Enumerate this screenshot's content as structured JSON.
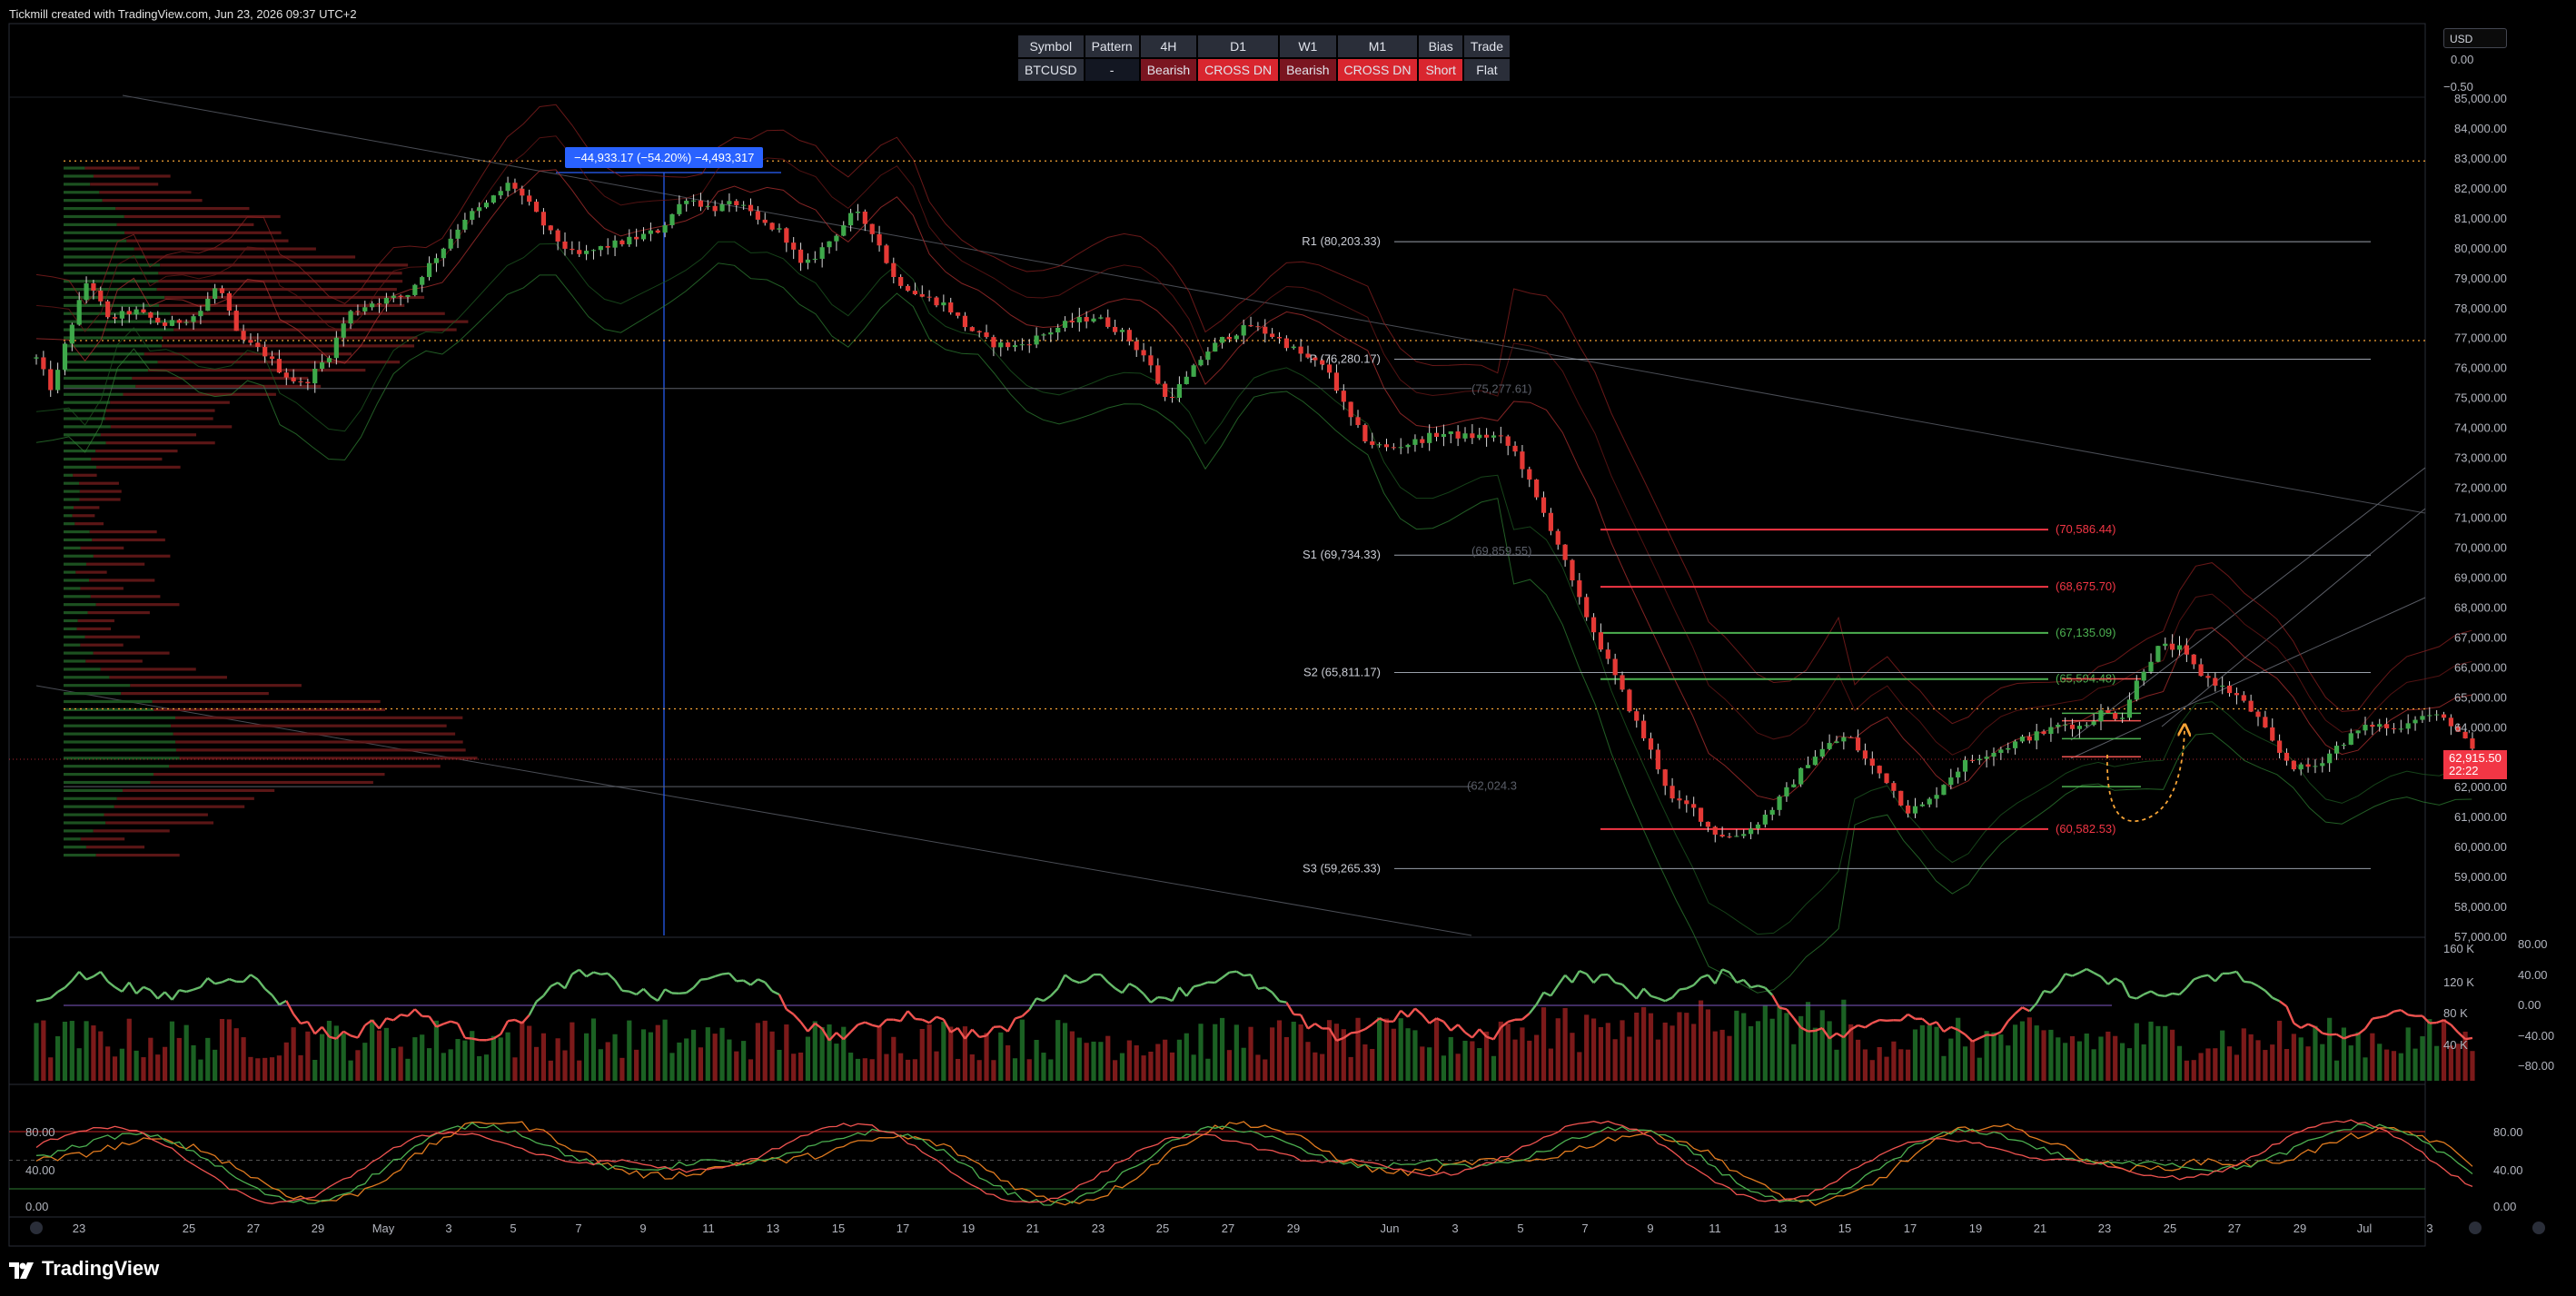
{
  "header": {
    "text": "Tickmill created with TradingView.com, Jun 23, 2026 09:37 UTC+2"
  },
  "footer": {
    "logo_text": "TradingView"
  },
  "currency": {
    "label": "USD"
  },
  "measure_label": "−44,933.17 (−54.20%) −4,493,317",
  "price_tag": {
    "price": "62,915.50",
    "countdown": "22:22"
  },
  "colors": {
    "up": "#26a69a",
    "upBar": "#2e7d32",
    "down": "#ef5350",
    "downBar": "#b71c1c",
    "orange": "#f7a436"
  },
  "signal_table": {
    "headers": [
      "Symbol",
      "Pattern",
      "4H",
      "D1",
      "W1",
      "M1",
      "Bias",
      "Trade"
    ],
    "row": [
      "BTCUSD",
      "-",
      "Bearish",
      "CROSS DN",
      "Bearish",
      "CROSS DN",
      "Short",
      "Flat"
    ]
  },
  "chart_data": {
    "type": "candlestick",
    "symbol": "BTCUSD",
    "price_axis": {
      "ticks": [
        "85,000.00",
        "84,000.00",
        "83,000.00",
        "82,000.00",
        "81,000.00",
        "80,000.00",
        "79,000.00",
        "78,000.00",
        "77,000.00",
        "76,000.00",
        "75,000.00",
        "74,000.00",
        "73,000.00",
        "72,000.00",
        "71,000.00",
        "70,000.00",
        "69,000.00",
        "68,000.00",
        "67,000.00",
        "66,000.00",
        "65,000.00",
        "64,000.00",
        "63,000.00",
        "62,000.00",
        "61,000.00",
        "60,000.00",
        "59,000.00",
        "58,000.00",
        "57,000.00"
      ],
      "ylim": [
        57000,
        85000
      ]
    },
    "time_axis": [
      "23",
      "25",
      "27",
      "29",
      "May",
      "3",
      "5",
      "7",
      "9",
      "11",
      "13",
      "15",
      "17",
      "19",
      "21",
      "23",
      "25",
      "27",
      "29",
      "Jun",
      "3",
      "5",
      "7",
      "9",
      "11",
      "13",
      "15",
      "17",
      "19",
      "21",
      "23",
      "25",
      "27",
      "29",
      "Jul",
      "3"
    ],
    "pivot_levels": [
      {
        "label": "R1 (80,203.33)",
        "value": 80203.33
      },
      {
        "label": "P (76,280.17)",
        "value": 76280.17
      },
      {
        "label": "S1 (69,734.33)",
        "value": 69734.33
      },
      {
        "label": "S2 (65,811.17)",
        "value": 65811.17
      },
      {
        "label": "S3 (59,265.33)",
        "value": 59265.33
      }
    ],
    "target_levels": [
      {
        "label": "(70,586.44)",
        "value": 70586.44,
        "color": "#f23645"
      },
      {
        "label": "(68,675.70)",
        "value": 68675.7,
        "color": "#f23645"
      },
      {
        "label": "(67,135.09)",
        "value": 67135.09,
        "color": "#4caf50"
      },
      {
        "label": "(65,594.48)",
        "value": 65594.48,
        "color": "#4caf50"
      },
      {
        "label": "(60,582.53)",
        "value": 60582.53,
        "color": "#f23645"
      }
    ],
    "faint_labels": [
      {
        "label": "(75,277.61)",
        "value": 75277.61
      },
      {
        "label": "(69,859.55)",
        "value": 69859.55
      },
      {
        "label": "(62,024.3",
        "value": 62024.3
      }
    ],
    "dotted_levels": [
      82900,
      76900,
      64600
    ],
    "close_path": [
      [
        22.0,
        76300
      ],
      [
        22.5,
        75200
      ],
      [
        23,
        77200
      ],
      [
        23.6,
        79000
      ],
      [
        24.2,
        77600
      ],
      [
        25,
        77900
      ],
      [
        26,
        77400
      ],
      [
        27,
        77800
      ],
      [
        27.6,
        78800
      ],
      [
        28.2,
        77000
      ],
      [
        29,
        76500
      ],
      [
        29.6,
        75800
      ],
      [
        30.2,
        75400
      ],
      [
        31,
        76400
      ],
      [
        31.6,
        77800
      ],
      [
        32.4,
        78200
      ],
      [
        33.4,
        78400
      ],
      [
        34,
        79300
      ],
      [
        34.6,
        80100
      ],
      [
        35.2,
        81000
      ],
      [
        35.8,
        81400
      ],
      [
        36.6,
        82200
      ],
      [
        37.2,
        81400
      ],
      [
        37.8,
        80500
      ],
      [
        38.6,
        79700
      ],
      [
        39.4,
        80000
      ],
      [
        40.4,
        80300
      ],
      [
        41.2,
        80600
      ],
      [
        42,
        81700
      ],
      [
        42.8,
        81300
      ],
      [
        43.6,
        81500
      ],
      [
        44.2,
        80900
      ],
      [
        45,
        80500
      ],
      [
        45.6,
        79300
      ],
      [
        46.4,
        80200
      ],
      [
        47.2,
        81200
      ],
      [
        47.8,
        80500
      ],
      [
        48.4,
        79000
      ],
      [
        49.2,
        78400
      ],
      [
        50,
        78100
      ],
      [
        50.6,
        77400
      ],
      [
        51.4,
        76800
      ],
      [
        52.2,
        76700
      ],
      [
        53,
        77100
      ],
      [
        53.8,
        77500
      ],
      [
        54.6,
        77700
      ],
      [
        55.4,
        77200
      ],
      [
        56.2,
        76300
      ],
      [
        56.8,
        74900
      ],
      [
        57.4,
        75600
      ],
      [
        58,
        76500
      ],
      [
        58.6,
        77000
      ],
      [
        59.4,
        77400
      ],
      [
        60.2,
        77000
      ],
      [
        61,
        76400
      ],
      [
        61.8,
        75900
      ],
      [
        62.4,
        74400
      ],
      [
        63,
        73500
      ],
      [
        63.6,
        73300
      ],
      [
        64.4,
        73500
      ],
      [
        65.2,
        73800
      ],
      [
        66,
        73700
      ],
      [
        67,
        73700
      ],
      [
        67.6,
        73100
      ],
      [
        68.2,
        71600
      ],
      [
        68.8,
        70300
      ],
      [
        69.4,
        68500
      ],
      [
        70,
        67100
      ],
      [
        70.6,
        65700
      ],
      [
        71.2,
        64300
      ],
      [
        71.8,
        63000
      ],
      [
        72.4,
        61500
      ],
      [
        73,
        61300
      ],
      [
        73.6,
        60500
      ],
      [
        74.2,
        60300
      ],
      [
        74.8,
        60600
      ],
      [
        75.4,
        61200
      ],
      [
        76,
        62000
      ],
      [
        76.6,
        62900
      ],
      [
        77.2,
        63400
      ],
      [
        77.8,
        63700
      ],
      [
        78.4,
        62800
      ],
      [
        79,
        62200
      ],
      [
        79.6,
        61200
      ],
      [
        80.2,
        61400
      ],
      [
        80.8,
        62200
      ],
      [
        81.4,
        62800
      ],
      [
        82,
        63100
      ],
      [
        82.6,
        63300
      ],
      [
        83.2,
        63600
      ],
      [
        83.8,
        63800
      ],
      [
        84.4,
        64100
      ],
      [
        85,
        64000
      ],
      [
        85.6,
        64500
      ],
      [
        86.2,
        64300
      ],
      [
        86.8,
        65800
      ],
      [
        87.4,
        66700
      ],
      [
        88,
        66600
      ],
      [
        88.6,
        65800
      ],
      [
        89.2,
        65400
      ],
      [
        89.8,
        65000
      ],
      [
        90.4,
        64300
      ],
      [
        91,
        63200
      ],
      [
        91.6,
        62600
      ],
      [
        92.2,
        62700
      ],
      [
        92.8,
        63300
      ],
      [
        93.4,
        63800
      ],
      [
        94,
        64100
      ],
      [
        94.6,
        63900
      ],
      [
        95.2,
        64300
      ],
      [
        95.8,
        64400
      ],
      [
        96.4,
        64100
      ],
      [
        96.8,
        63500
      ],
      [
        97.2,
        62915
      ]
    ],
    "indicators": [
      "Volume Profile",
      "Bollinger Bands",
      "Pivot Points",
      "Volume",
      "Oscillator (-80 to 80)",
      "Stochastic (0-100)"
    ],
    "volume_axis": [
      "160 K",
      "120 K",
      "80 K",
      "40 K"
    ],
    "osc_axis": [
      "80.00",
      "40.00",
      "0.00",
      "−40.00",
      "−80.00"
    ],
    "stoch_axis": [
      "80.00",
      "40.00",
      "0.00"
    ],
    "top_scale": [
      "0.00",
      "−0.50"
    ]
  }
}
